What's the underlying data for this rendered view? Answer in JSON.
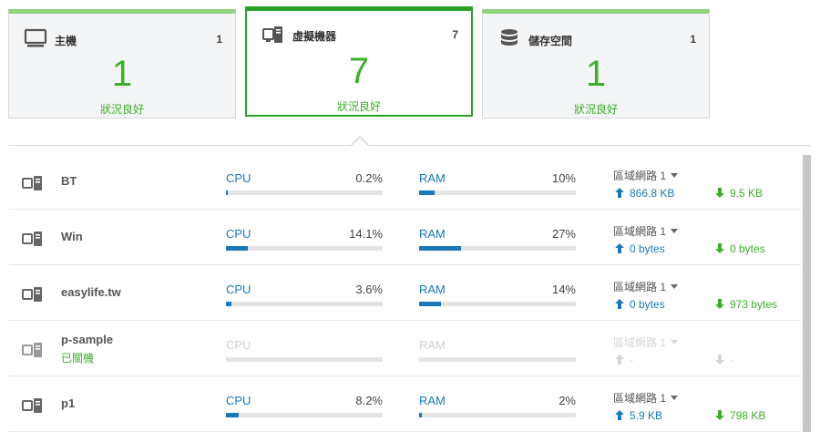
{
  "summary": {
    "host": {
      "title": "主機",
      "count": "1",
      "big": "1",
      "status": "狀況良好"
    },
    "vm": {
      "title": "虛擬機器",
      "count": "7",
      "big": "7",
      "status": "狀況良好"
    },
    "storage": {
      "title": "儲存空間",
      "count": "1",
      "big": "1",
      "status": "狀況良好"
    }
  },
  "colors": {
    "accent_green": "#3dae2b",
    "active_border": "#2aa12a",
    "bar_blue": "#1a78b8"
  },
  "vms": [
    {
      "name": "BT",
      "sub": "",
      "cpu_label": "CPU",
      "cpu_value": "0.2%",
      "cpu_level": 0.2,
      "ram_label": "RAM",
      "ram_value": "10%",
      "ram_level": 10,
      "net_label": "區域網路 1",
      "up": "866.8 KB",
      "down": "9.5 KB",
      "off": false
    },
    {
      "name": "Win",
      "sub": "",
      "cpu_label": "CPU",
      "cpu_value": "14.1%",
      "cpu_level": 14.1,
      "ram_label": "RAM",
      "ram_value": "27%",
      "ram_level": 27,
      "net_label": "區域網路 1",
      "up": "0 bytes",
      "down": "0 bytes",
      "off": false
    },
    {
      "name": "easylife.tw",
      "sub": "",
      "cpu_label": "CPU",
      "cpu_value": "3.6%",
      "cpu_level": 3.6,
      "ram_label": "RAM",
      "ram_value": "14%",
      "ram_level": 14,
      "net_label": "區域網路 1",
      "up": "0 bytes",
      "down": "973 bytes",
      "off": false
    },
    {
      "name": "p-sample",
      "sub": "已關機",
      "cpu_label": "CPU",
      "cpu_value": "",
      "cpu_level": 0,
      "ram_label": "RAM",
      "ram_value": "",
      "ram_level": 0,
      "net_label": "區域網路 1",
      "up": "-",
      "down": "-",
      "off": true
    },
    {
      "name": "p1",
      "sub": "",
      "cpu_label": "CPU",
      "cpu_value": "8.2%",
      "cpu_level": 8.2,
      "ram_label": "RAM",
      "ram_value": "2%",
      "ram_level": 2,
      "net_label": "區域網路 1",
      "up": "5.9 KB",
      "down": "798 KB",
      "off": false
    }
  ]
}
